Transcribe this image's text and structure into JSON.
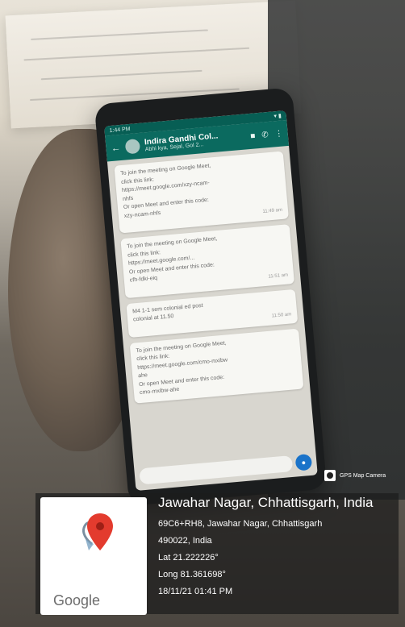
{
  "phone": {
    "status": {
      "time": "1:44 PM",
      "icons": "▾ ▮"
    },
    "chat_header": {
      "title": "Indira Gandhi Col...",
      "subtitle": "Abhi kya, Sejal, Gol 2...",
      "icons": [
        "back-arrow-icon",
        "video-call-icon",
        "voice-call-icon",
        "menu-dots-icon"
      ]
    },
    "messages": [
      {
        "lines": [
          "To join the meeting on Google Meet,",
          "click this link:",
          "https://meet.google.com/xzy-ncam-",
          "nhfs",
          "Or open Meet and enter this code:",
          "xzy-ncam-nhfs"
        ],
        "time": "11:49 am"
      },
      {
        "lines": [
          "To join the meeting on Google Meet,",
          "click this link:",
          "https://meet.google.com/...",
          "Or open Meet and enter this code:",
          "cfh-fdki-eiq"
        ],
        "time": "11:51 am"
      },
      {
        "lines": [
          "M4 1-1 sem colonial ed post",
          "colonial at 11.50"
        ],
        "time": "11:50 am"
      },
      {
        "lines": [
          "To join the meeting on Google Meet,",
          "click this link:",
          "https://meet.google.com/cmo-mxibw",
          "ahe",
          "Or open Meet and enter this code:",
          "cmo-mxibw-ahe"
        ],
        "time": ""
      }
    ]
  },
  "gps_badge": {
    "label": "GPS Map Camera",
    "icon": "camera-icon"
  },
  "location": {
    "title": "Jawahar Nagar, Chhattisgarh, India",
    "address_line1": "69C6+RH8, Jawahar Nagar, Chhattisgarh",
    "address_line2": "490022, India",
    "lat": "Lat 21.222226°",
    "long": "Long 81.361698°",
    "datetime": "18/11/21 01:41 PM"
  },
  "map": {
    "logo_text": "Google",
    "pin_icon": "map-pin-icon"
  },
  "colors": {
    "overlay": "#1c1c1c",
    "pin": "#e33b2e",
    "whatsapp_header": "#0b6a5f"
  }
}
